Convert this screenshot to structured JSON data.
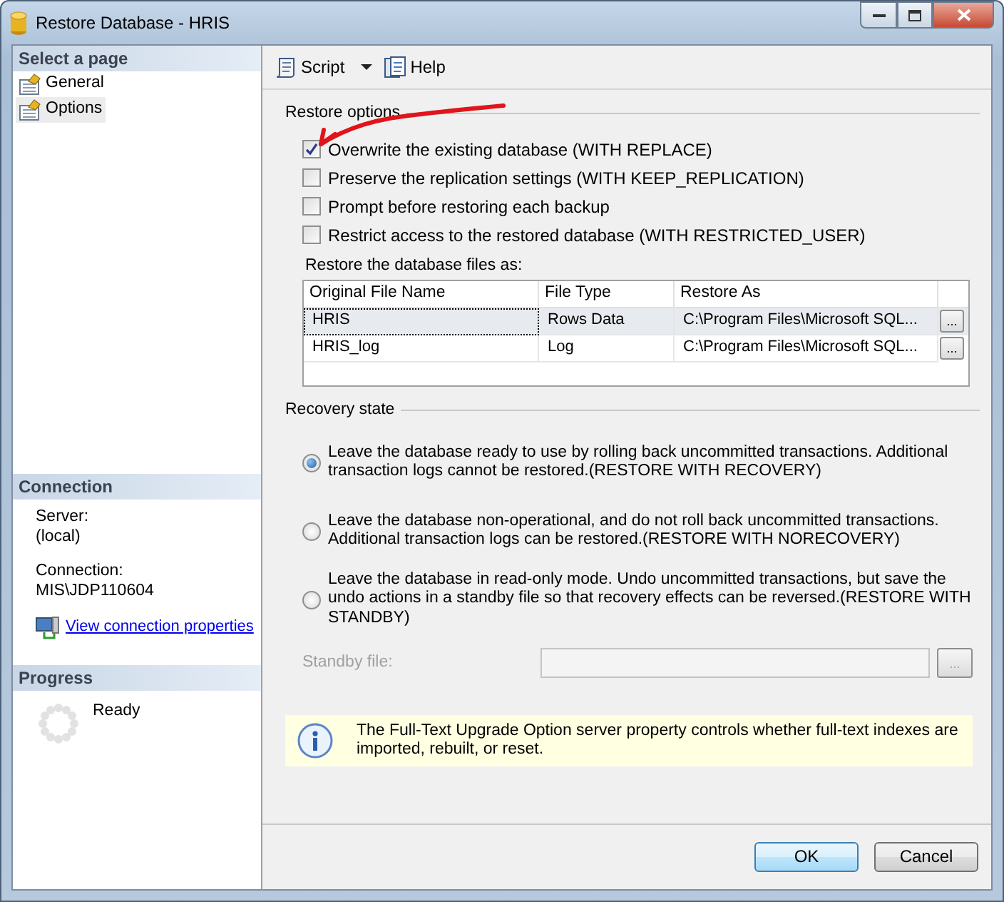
{
  "window": {
    "title": "Restore Database - HRIS"
  },
  "sidebar": {
    "title": "Select a page",
    "items": [
      {
        "label": "General",
        "selected": false
      },
      {
        "label": "Options",
        "selected": true
      }
    ]
  },
  "connection": {
    "title": "Connection",
    "fields": [
      {
        "label": "Server:",
        "value": "(local)"
      },
      {
        "label": "Connection:",
        "value": "MIS\\JDP110604"
      }
    ],
    "link": "View connection properties"
  },
  "progress": {
    "title": "Progress",
    "status": "Ready"
  },
  "toolbar": [
    {
      "label": "Script",
      "kind": "script"
    },
    {
      "label": "Help",
      "kind": "help"
    }
  ],
  "restore_options": {
    "title": "Restore options",
    "options": [
      {
        "label": "Overwrite the existing database (WITH REPLACE)",
        "checked": true
      },
      {
        "label": "Preserve the replication settings (WITH KEEP_REPLICATION)",
        "checked": false
      },
      {
        "label": "Prompt before restoring each backup",
        "checked": false
      },
      {
        "label": "Restrict access to the restored database (WITH RESTRICTED_USER)",
        "checked": false
      }
    ]
  },
  "files": {
    "label": "Restore the database files as:",
    "columns": [
      "Original File Name",
      "File Type",
      "Restore As"
    ],
    "rows": [
      {
        "cells": [
          "HRIS",
          "Rows Data",
          "C:\\Program Files\\Microsoft SQL..."
        ],
        "button": "...",
        "selected": true
      },
      {
        "cells": [
          "HRIS_log",
          "Log",
          "C:\\Program Files\\Microsoft SQL..."
        ],
        "button": "...",
        "selected": false
      }
    ]
  },
  "recovery": {
    "title": "Recovery state",
    "options": [
      {
        "label": "Leave the database ready to use by rolling back uncommitted transactions. Additional transaction logs cannot be restored.(RESTORE WITH RECOVERY)",
        "selected": true
      },
      {
        "label": "Leave the database non-operational, and do not roll back uncommitted transactions. Additional transaction logs can be restored.(RESTORE WITH NORECOVERY)",
        "selected": false
      },
      {
        "label": "Leave the database in read-only mode. Undo uncommitted transactions, but save the undo actions in a standby file so that recovery effects can be reversed.(RESTORE WITH STANDBY)",
        "selected": false
      }
    ]
  },
  "standby": {
    "label": "Standby file:",
    "disabled": true,
    "button": "..."
  },
  "info": "The Full-Text Upgrade Option server property controls whether full-text indexes are imported, rebuilt, or reset.",
  "buttons": [
    {
      "label": "OK",
      "default": true
    },
    {
      "label": "Cancel",
      "default": false
    }
  ]
}
